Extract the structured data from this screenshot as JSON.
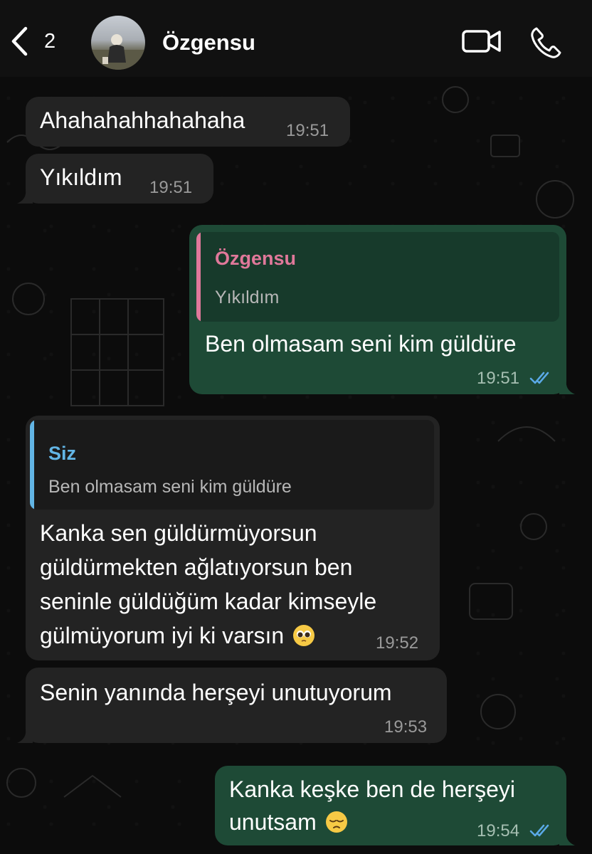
{
  "header": {
    "back_count": "2",
    "contact_name": "Özgensu"
  },
  "messages": [
    {
      "direction": "in",
      "text": "Ahahahahhahahaha",
      "time": "19:51"
    },
    {
      "direction": "in",
      "text": "Yıkıldım",
      "time": "19:51"
    },
    {
      "direction": "out",
      "quote": {
        "name": "Özgensu",
        "text": "Yıkıldım"
      },
      "text": "Ben olmasam seni kim güldüre",
      "time": "19:51",
      "status": "read"
    },
    {
      "direction": "in",
      "quote": {
        "name": "Siz",
        "text": "Ben olmasam seni kim güldüre"
      },
      "lines": [
        "Kanka sen güldürmüyorsun",
        "güldürmekten ağlatıyorsun ben",
        "seninle güldüğüm kadar kimseyle",
        "gülmüyorum iyi ki varsın"
      ],
      "emoji": "pleading-face",
      "time": "19:52"
    },
    {
      "direction": "in",
      "text": "Senin yanında herşeyi unutuyorum",
      "time": "19:53"
    },
    {
      "direction": "out",
      "lines": [
        "Kanka keşke ben de herşeyi",
        "unutsam"
      ],
      "emoji": "pensive-face",
      "time": "19:54",
      "status": "read"
    }
  ],
  "colors": {
    "incoming_bubble": "#232323",
    "outgoing_bubble": "#1e4a36",
    "quote_name_contact": "#e0789a",
    "quote_name_self": "#62b5e5",
    "read_ticks": "#5aa9e6"
  }
}
